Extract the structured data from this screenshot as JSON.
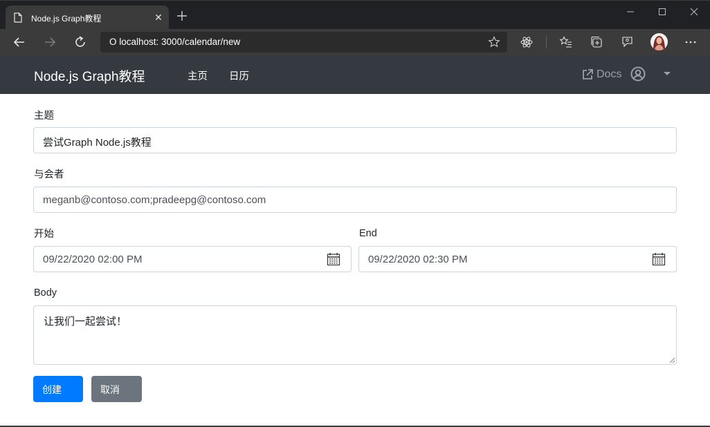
{
  "browser": {
    "tab_title": "Node.js Graph教程",
    "tab_close": "✕",
    "url": "O localhost: 3000/calendar/new"
  },
  "navbar": {
    "brand": "Node.js Graph教程",
    "links": [
      {
        "label": "主页"
      },
      {
        "label": "日历"
      }
    ],
    "docs_label": "Docs"
  },
  "form": {
    "subject": {
      "label": "主题",
      "value": "尝试Graph Node.js教程"
    },
    "attendees": {
      "label": "与会者",
      "value": "meganb@contoso.com;pradeepg@contoso.com"
    },
    "start": {
      "label": "开始",
      "value": "09/22/2020 02:00 PM"
    },
    "end": {
      "label": "End",
      "value": "09/22/2020 02:30 PM"
    },
    "body": {
      "label": "Body",
      "value": "让我们一起尝试！"
    },
    "create_label": "创建",
    "cancel_label": "取消"
  },
  "icons": {
    "page": "page-icon",
    "close": "close-icon",
    "new_tab": "plus-icon",
    "back": "back-arrow-icon",
    "forward": "forward-arrow-icon",
    "refresh": "refresh-icon",
    "favorite": "star-icon",
    "extension": "react-icon",
    "favorites_bar": "favorites-icon",
    "collections": "collections-icon",
    "feedback": "feedback-icon",
    "more": "more-icon",
    "docs": "external-link-icon",
    "user": "user-circle-icon",
    "calendar": "calendar-icon"
  },
  "colors": {
    "navbar_bg": "#343a40",
    "primary": "#007bff",
    "secondary": "#6c757d",
    "chrome_bg": "#202124"
  }
}
